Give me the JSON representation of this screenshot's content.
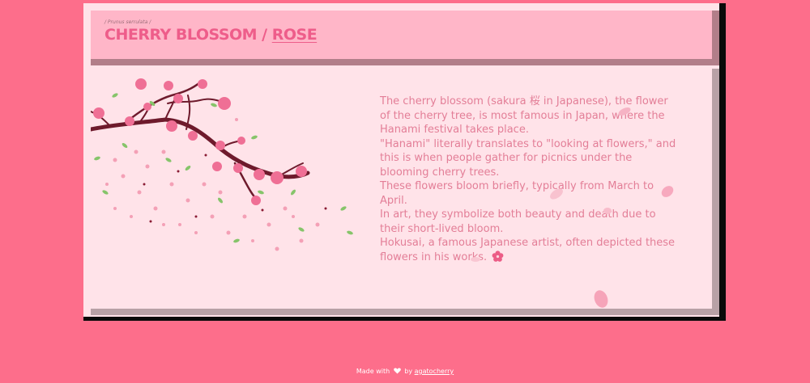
{
  "header": {
    "subtitle": "/ Prunus serrulata /",
    "title_prefix": "CHERRY BLOSSOM / ",
    "title_link": "ROSE"
  },
  "content": {
    "paragraphs": [
      "The cherry blossom (sakura 桜 in Japanese), the flower of the cherry tree, is most famous in Japan, where the Hanami festival takes place.",
      "\"Hanami\" literally translates to \"looking at flowers,\" and this is when people gather for picnics under the blooming cherry trees.",
      "These flowers bloom briefly, typically from March to April.",
      "In art, they symbolize both beauty and death due to their short-lived bloom.",
      "Hokusai, a famous Japanese artist, often depicted these flowers in his works."
    ],
    "end_icon": "cherry-blossom-icon"
  },
  "footer": {
    "made_with": "Made with",
    "by": "by",
    "author": "agatocherry",
    "icon": "heart-icon"
  },
  "colors": {
    "page_background": "#fd6e8b",
    "header_background": "#ffb6c8",
    "panel_background": "#ffe3e9",
    "title_color": "#ee5d8a",
    "text_color": "#e37e97",
    "shadow": "#0a0a0a"
  }
}
